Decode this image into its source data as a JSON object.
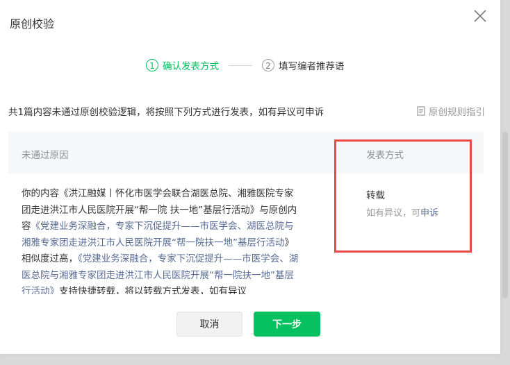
{
  "dialog": {
    "title": "原创校验",
    "close_icon": "close-icon"
  },
  "steps": [
    {
      "num": "1",
      "label": "确认发表方式",
      "active": true
    },
    {
      "num": "2",
      "label": "填写编者推荐语",
      "active": false
    }
  ],
  "notice": "共1篇内容未通过原创校验逻辑，将按照下列方式进行发表，如有异议可申诉",
  "rules_link": {
    "label": "原创规则指引",
    "icon": "document-icon"
  },
  "table": {
    "headers": {
      "reason": "未通过原因",
      "method": "发表方式"
    },
    "reason": {
      "prefix": "你的内容《洪江融媒丨怀化市医学会联合湖医总院、湘雅医院专家团走进洪江市人民医院开展“帮一院 扶一地”基层行活动》与原创内容",
      "link1": "《党建业务深融合，专家下沉促提升——市医学会、湖医总院与湘雅专家团走进洪江市人民医院开展“帮一院扶一地”基层行活动",
      "middle": "》相似度过高，",
      "link2": "《党建业务深融合，专家下沉促提升——市医学会、湖医总院与湘雅专家团走进洪江市人民医院开展“帮一院扶一地”基层行活动》",
      "suffix": "支持快捷转载，将以转载方式发表，如有异议"
    },
    "method": {
      "main": "转载",
      "sub_prefix": "如有异议，可",
      "appeal": "申诉"
    }
  },
  "buttons": {
    "cancel": "取消",
    "next": "下一步"
  },
  "colors": {
    "accent": "#07c160",
    "link": "#576b95",
    "highlight": "#e84a4a"
  }
}
